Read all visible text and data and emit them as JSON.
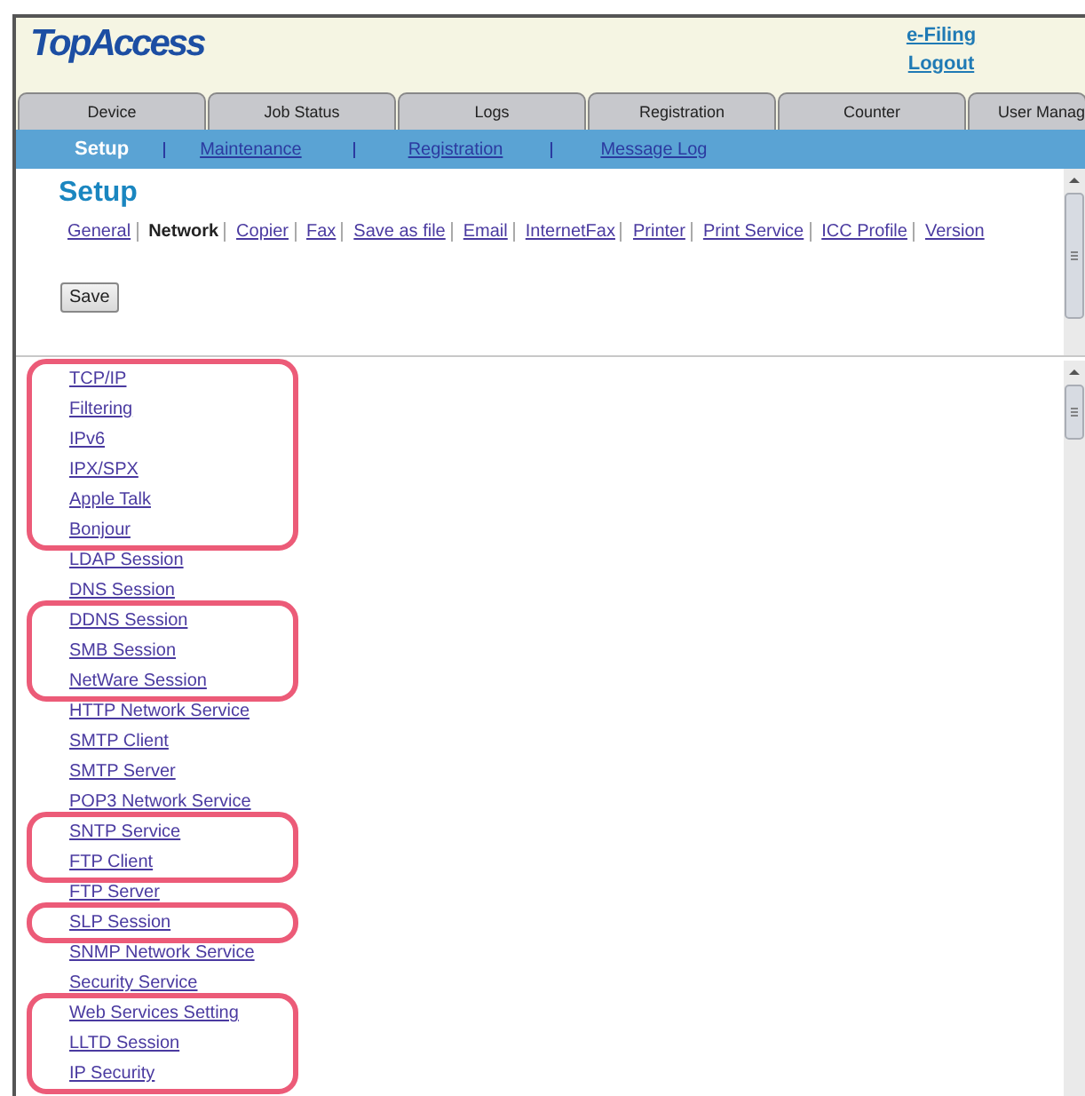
{
  "header": {
    "logo": "TopAccess",
    "links": [
      "e-Filing",
      "Logout"
    ]
  },
  "tabs": [
    {
      "label": "Device",
      "selected": false
    },
    {
      "label": "Job Status",
      "selected": false
    },
    {
      "label": "Logs",
      "selected": false
    },
    {
      "label": "Registration",
      "selected": false
    },
    {
      "label": "Counter",
      "selected": false
    },
    {
      "label": "User Manag",
      "selected": false
    }
  ],
  "sub_nav": [
    {
      "label": "Setup",
      "selected": true
    },
    {
      "label": "Maintenance",
      "selected": false
    },
    {
      "label": "Registration",
      "selected": false
    },
    {
      "label": "Message Log",
      "selected": false
    }
  ],
  "setup": {
    "title": "Setup",
    "categories": [
      {
        "label": "General",
        "selected": false
      },
      {
        "label": "Network",
        "selected": true
      },
      {
        "label": "Copier",
        "selected": false
      },
      {
        "label": "Fax",
        "selected": false
      },
      {
        "label": "Save as file",
        "selected": false
      },
      {
        "label": "Email",
        "selected": false
      },
      {
        "label": "InternetFax",
        "selected": false
      },
      {
        "label": "Printer",
        "selected": false
      },
      {
        "label": "Print Service",
        "selected": false
      },
      {
        "label": "ICC Profile",
        "selected": false
      },
      {
        "label": "Version",
        "selected": false
      }
    ],
    "save_button": "Save"
  },
  "network_links": [
    {
      "highlighted": true,
      "items": [
        "TCP/IP",
        "Filtering",
        "IPv6",
        "IPX/SPX",
        "Apple Talk",
        "Bonjour"
      ]
    },
    {
      "highlighted": false,
      "items": [
        "LDAP Session",
        "DNS Session"
      ]
    },
    {
      "highlighted": true,
      "items": [
        "DDNS Session",
        "SMB Session",
        "NetWare Session"
      ]
    },
    {
      "highlighted": false,
      "items": [
        "HTTP Network Service",
        "SMTP Client",
        "SMTP Server",
        "POP3 Network Service"
      ]
    },
    {
      "highlighted": true,
      "items": [
        "SNTP Service",
        "FTP Client"
      ]
    },
    {
      "highlighted": false,
      "items": [
        "FTP Server"
      ]
    },
    {
      "highlighted": true,
      "items": [
        "SLP Session"
      ]
    },
    {
      "highlighted": false,
      "items": [
        "SNMP Network Service",
        "Security Service"
      ]
    },
    {
      "highlighted": true,
      "items": [
        "Web Services Setting",
        "LLTD Session",
        "IP Security"
      ]
    }
  ]
}
